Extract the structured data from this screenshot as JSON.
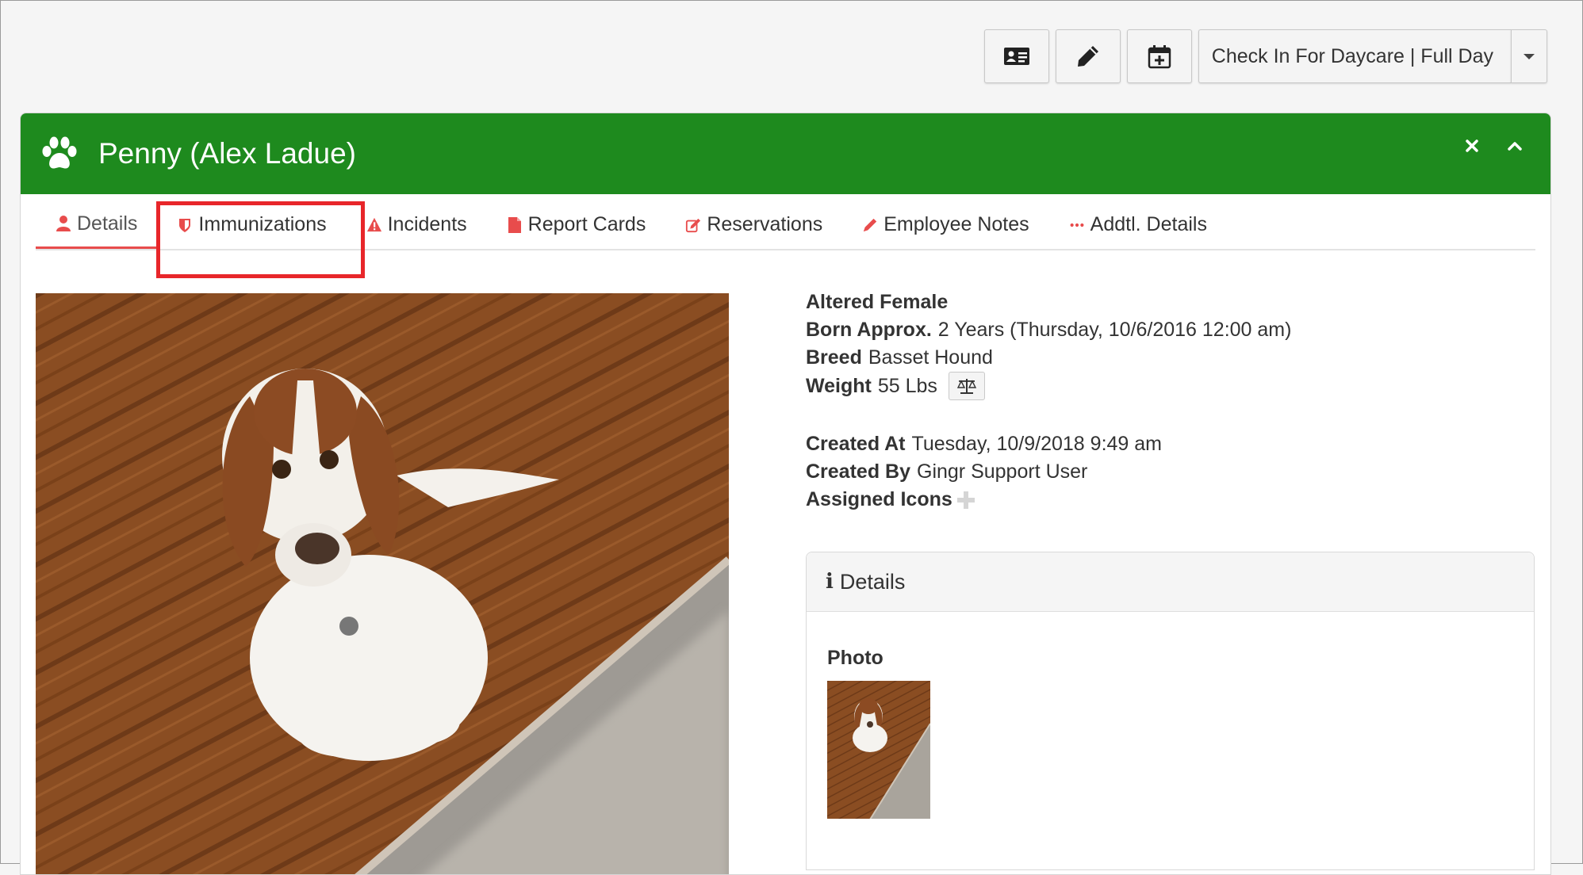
{
  "toolbar": {
    "icons": [
      "id-card-icon",
      "pencil-icon",
      "calendar-plus-icon"
    ],
    "checkin_label": "Check In For Daycare | Full Day"
  },
  "panel": {
    "title": "Penny (Alex Ladue)",
    "header_color": "#1e8a1e"
  },
  "tabs": [
    {
      "label": "Details",
      "icon": "user-icon",
      "active": true
    },
    {
      "label": "Immunizations",
      "icon": "shield-icon",
      "active": false
    },
    {
      "label": "Incidents",
      "icon": "warning-icon",
      "active": false
    },
    {
      "label": "Report Cards",
      "icon": "file-icon",
      "active": false
    },
    {
      "label": "Reservations",
      "icon": "edit-icon",
      "active": false
    },
    {
      "label": "Employee Notes",
      "icon": "pencil-icon",
      "active": false
    },
    {
      "label": "Addtl. Details",
      "icon": "ellipsis-icon",
      "active": false
    }
  ],
  "info": {
    "sex": "Altered Female",
    "born_label": "Born Approx.",
    "born_value": "2 Years (Thursday, 10/6/2016 12:00 am)",
    "breed_label": "Breed",
    "breed_value": "Basset Hound",
    "weight_label": "Weight",
    "weight_value": "55 Lbs",
    "created_at_label": "Created At",
    "created_at_value": "Tuesday, 10/9/2018 9:49 am",
    "created_by_label": "Created By",
    "created_by_value": "Gingr Support User",
    "assigned_icons_label": "Assigned Icons"
  },
  "details_panel": {
    "title": "Details",
    "photo_label": "Photo"
  },
  "colors": {
    "accent_red": "#e84c4c",
    "highlight_red": "#e8262a"
  }
}
